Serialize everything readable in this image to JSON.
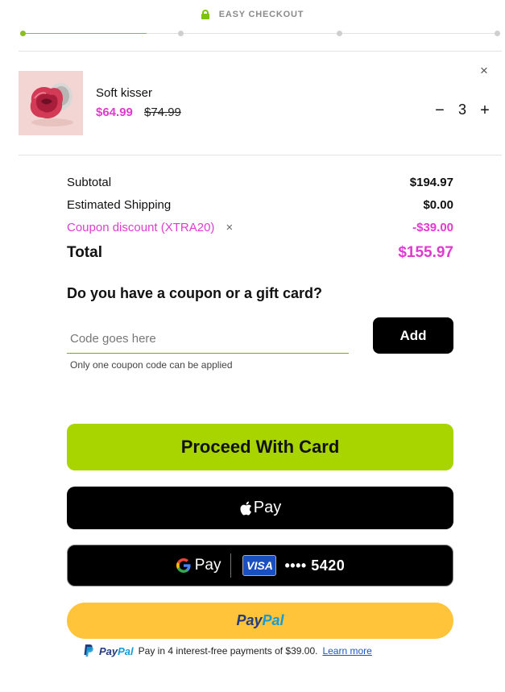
{
  "header": {
    "title": "EASY CHECKOUT"
  },
  "progress": {
    "current_step": 1,
    "total_steps": 4
  },
  "cart": {
    "items": [
      {
        "name": "Soft kisser",
        "price": "$64.99",
        "original_price": "$74.99",
        "quantity": "3",
        "minus": "−",
        "plus": "+",
        "remove": "×"
      }
    ]
  },
  "summary": {
    "subtotal_label": "Subtotal",
    "subtotal_value": "$194.97",
    "shipping_label": "Estimated Shipping",
    "shipping_value": "$0.00",
    "coupon_label": "Coupon discount (XTRA20)",
    "coupon_remove": "×",
    "coupon_value": "-$39.00",
    "total_label": "Total",
    "total_value": "$155.97"
  },
  "coupon": {
    "heading": "Do you have a coupon or a gift card?",
    "placeholder": "Code goes here",
    "add_label": "Add",
    "hint": "Only one coupon code can be applied"
  },
  "payment": {
    "card_label": "Proceed With Card",
    "apple_label": "Pay",
    "gpay_g": "G",
    "gpay_label": "Pay",
    "visa_label": "VISA",
    "card_masked": "•••• 5420",
    "paypal_pay": "Pay",
    "paypal_pal": "Pal",
    "paypal_message": "Pay in 4 interest-free payments of $39.00.",
    "learn_more": "Learn more"
  },
  "colors": {
    "accent_green": "#a8d400",
    "progress_green": "#8bbf1f",
    "price_pink": "#e03bd0",
    "paypal_yellow": "#ffc439",
    "paypal_dark_blue": "#253b80",
    "paypal_light_blue": "#179bd7",
    "visa_blue": "#1a4fbf"
  },
  "icons": {
    "lock": "lock-icon",
    "remove": "close-icon",
    "apple": "apple-icon",
    "google": "google-g-icon",
    "paypal": "paypal-icon"
  }
}
